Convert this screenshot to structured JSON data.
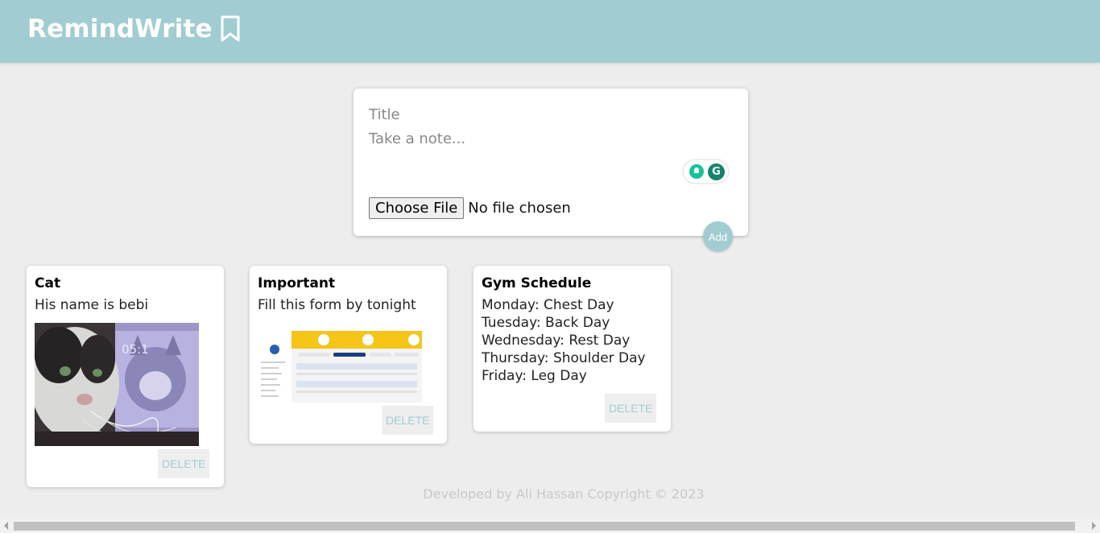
{
  "header": {
    "app_name": "RemindWrite",
    "bookmark_icon": "bookmark-icon",
    "bg_color": "#a1cdd2"
  },
  "composer": {
    "title_placeholder": "Title",
    "note_placeholder": "Take a note...",
    "choose_file_label": "Choose File",
    "file_status": "No file chosen",
    "add_label": "Add",
    "extension_icons": [
      "grammarly-lightbulb-icon",
      "grammarly-g-icon"
    ]
  },
  "notes": [
    {
      "title": "Cat",
      "content": "His name is bebi",
      "image": "cat-photo",
      "delete_label": "DELETE"
    },
    {
      "title": "Important",
      "content": "Fill this form by tonight",
      "image": "form-screenshot",
      "delete_label": "DELETE"
    },
    {
      "title": "Gym Schedule",
      "content": "Monday: Chest Day\nTuesday: Back Day\nWednesday: Rest Day\nThursday: Shoulder Day\nFriday: Leg Day",
      "delete_label": "DELETE"
    }
  ],
  "footer": {
    "text": "Developed by Ali Hassan Copyright © 2023"
  },
  "colors": {
    "accent": "#a1cdd2",
    "page_bg": "#ededed"
  }
}
